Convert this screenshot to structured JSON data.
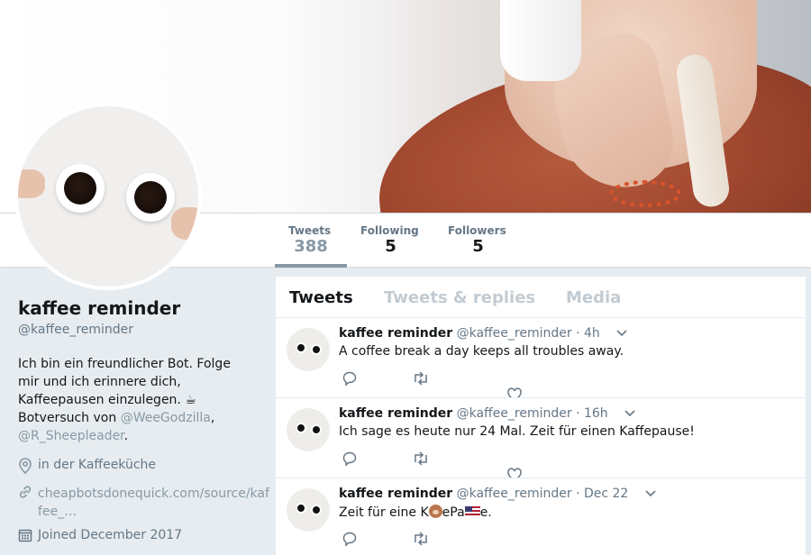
{
  "header": {
    "stats": [
      {
        "label": "Tweets",
        "value": "388"
      },
      {
        "label": "Following",
        "value": "5"
      },
      {
        "label": "Followers",
        "value": "5"
      }
    ]
  },
  "profile": {
    "name": "kaffee reminder",
    "handle": "@kaffee_reminder",
    "bio_text": "Ich bin ein freundlicher Bot. Folge mir und ich erinnere dich, Kaffeepausen einzulegen. ☕ Botversuch von",
    "bio_link1": "@WeeGodzilla",
    "bio_sep": ",",
    "bio_link2": "@R_Sheepleader",
    "bio_end": ".",
    "location": "in der Kaffeeküche",
    "website": "cheapbotsdonequick.com/source/kaffee_…",
    "joined": "Joined December 2017"
  },
  "timeline": {
    "tabs": [
      "Tweets",
      "Tweets & replies",
      "Media"
    ],
    "tweets": [
      {
        "name": "kaffee reminder",
        "handle": "@kaffee_reminder",
        "time": "· 4h",
        "text": "A coffee break a day keeps all troubles away."
      },
      {
        "name": "kaffee reminder",
        "handle": "@kaffee_reminder",
        "time": "· 16h",
        "text": "Ich sage es heute nur 24 Mal. Zeit für einen Kaffepause!"
      },
      {
        "name": "kaffee reminder",
        "handle": "@kaffee_reminder",
        "time": "· Dec 22",
        "text_a": "Zeit für eine K",
        "text_b": "ePa",
        "text_c": "e."
      }
    ]
  },
  "colors": {
    "link": "#8899a6",
    "text": "#14171a",
    "muted": "#657786",
    "background": "#e6ecf0"
  },
  "icons": [
    "location-icon",
    "link-icon",
    "calendar-icon",
    "reply-icon",
    "retweet-icon",
    "like-icon",
    "chevron-down-icon"
  ]
}
